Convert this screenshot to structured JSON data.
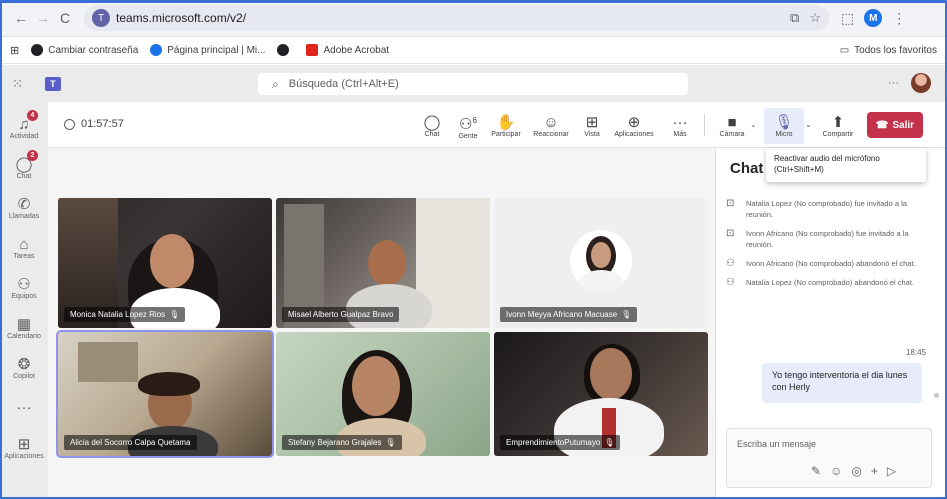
{
  "browser": {
    "url": "teams.microsoft.com/v2/",
    "bookmarks": [
      "Cambiar contraseña",
      "Página principal | Mi...",
      "",
      "Adobe Acrobat"
    ],
    "all_favorites": "Todos los favoritos"
  },
  "teams": {
    "search_placeholder": "Búsqueda (Ctrl+Alt+E)"
  },
  "rail": [
    {
      "label": "Actividad",
      "icon": "bell-icon",
      "badge": "4"
    },
    {
      "label": "Chat",
      "icon": "chat-icon",
      "badge": "2"
    },
    {
      "label": "Llamadas",
      "icon": "phone-icon",
      "badge": ""
    },
    {
      "label": "Tareas",
      "icon": "tasks-icon",
      "badge": ""
    },
    {
      "label": "Equipos",
      "icon": "teams-icon",
      "badge": ""
    },
    {
      "label": "Calendario",
      "icon": "calendar-icon",
      "badge": ""
    },
    {
      "label": "Copilot",
      "icon": "copilot-icon",
      "badge": ""
    },
    {
      "label": "",
      "icon": "more-icon",
      "badge": ""
    },
    {
      "label": "Aplicaciones",
      "icon": "apps-icon",
      "badge": ""
    }
  ],
  "meeting": {
    "timer": "01:57:57",
    "controls": {
      "chat": "Chat",
      "people": "Gente",
      "people_count": "6",
      "raise": "Participar",
      "react": "Reaccionar",
      "view": "Vista",
      "apps": "Aplicaciones",
      "more": "Más",
      "camera": "Cámara",
      "mic": "Micro",
      "share": "Compartir",
      "leave": "Salir"
    },
    "tooltip": "Reactivar audio del micrófono (Ctrl+Shift+M)",
    "participants": [
      {
        "name": "Monica Natalia Lopez Rios",
        "muted": true
      },
      {
        "name": "Misael Alberto Gualpaz Bravo",
        "muted": false
      },
      {
        "name": "Ivonn Meyya Africano Macuase",
        "muted": true
      },
      {
        "name": "Alicia del Socorro Calpa Quetama",
        "muted": false
      },
      {
        "name": "Stefany Bejarano Grajales",
        "muted": true
      },
      {
        "name": "EmprendimientoPutumayo",
        "muted": true
      }
    ]
  },
  "chat": {
    "title": "Chat d",
    "events": [
      {
        "icon": "invite-icon",
        "text": "Natalia Lopez (No comprobado) fue invitado a la reunión."
      },
      {
        "icon": "invite-icon",
        "text": "Ivonn Africano (No comprobado) fue invitado a la reunión."
      },
      {
        "icon": "leave-icon",
        "text": "Ivonn Africano (No comprobado) abandonó el chat."
      },
      {
        "icon": "leave-icon",
        "text": "Natalia Lopez (No comprobado) abandonó el chat."
      }
    ],
    "message_time": "18:45",
    "message": "Yo tengo interventoria el dia lunes con Herly",
    "compose_placeholder": "Escriba un mensaje"
  }
}
